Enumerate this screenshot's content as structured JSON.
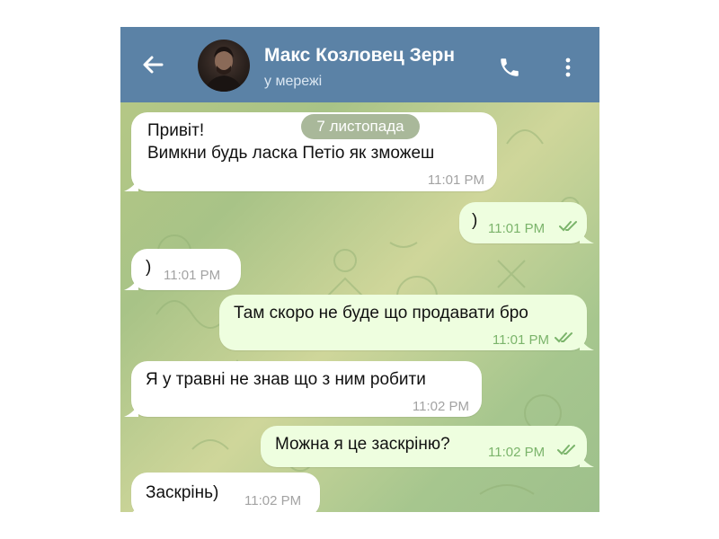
{
  "header": {
    "contact_name": "Макс Козловец Зерн",
    "status": "у мережі",
    "back_icon": "arrow-left-icon",
    "call_icon": "phone-icon",
    "menu_icon": "more-vertical-icon"
  },
  "date_separator": "7 листопада",
  "messages": [
    {
      "direction": "in",
      "lines": [
        "Привіт!",
        "Вимкни будь ласка Петіо як зможеш"
      ],
      "time": "11:01 PM"
    },
    {
      "direction": "out",
      "text": ")",
      "time": "11:01 PM",
      "read": true
    },
    {
      "direction": "in",
      "text": ")",
      "time": "11:01 PM"
    },
    {
      "direction": "out",
      "text": "Там скоро не буде що продавати бро",
      "time": "11:01 PM",
      "read": true
    },
    {
      "direction": "in",
      "text": "Я у травні не знав що з ним робити",
      "time": "11:02 PM"
    },
    {
      "direction": "out",
      "text": "Можна я це заскріню?",
      "time": "11:02 PM",
      "read": true
    },
    {
      "direction": "in",
      "text": "Заскрінь)",
      "time": "11:02 PM"
    }
  ],
  "colors": {
    "header": "#5b82a6",
    "incoming_bubble": "#ffffff",
    "outgoing_bubble": "#eefedf",
    "read_ticks": "#7bb46b"
  }
}
